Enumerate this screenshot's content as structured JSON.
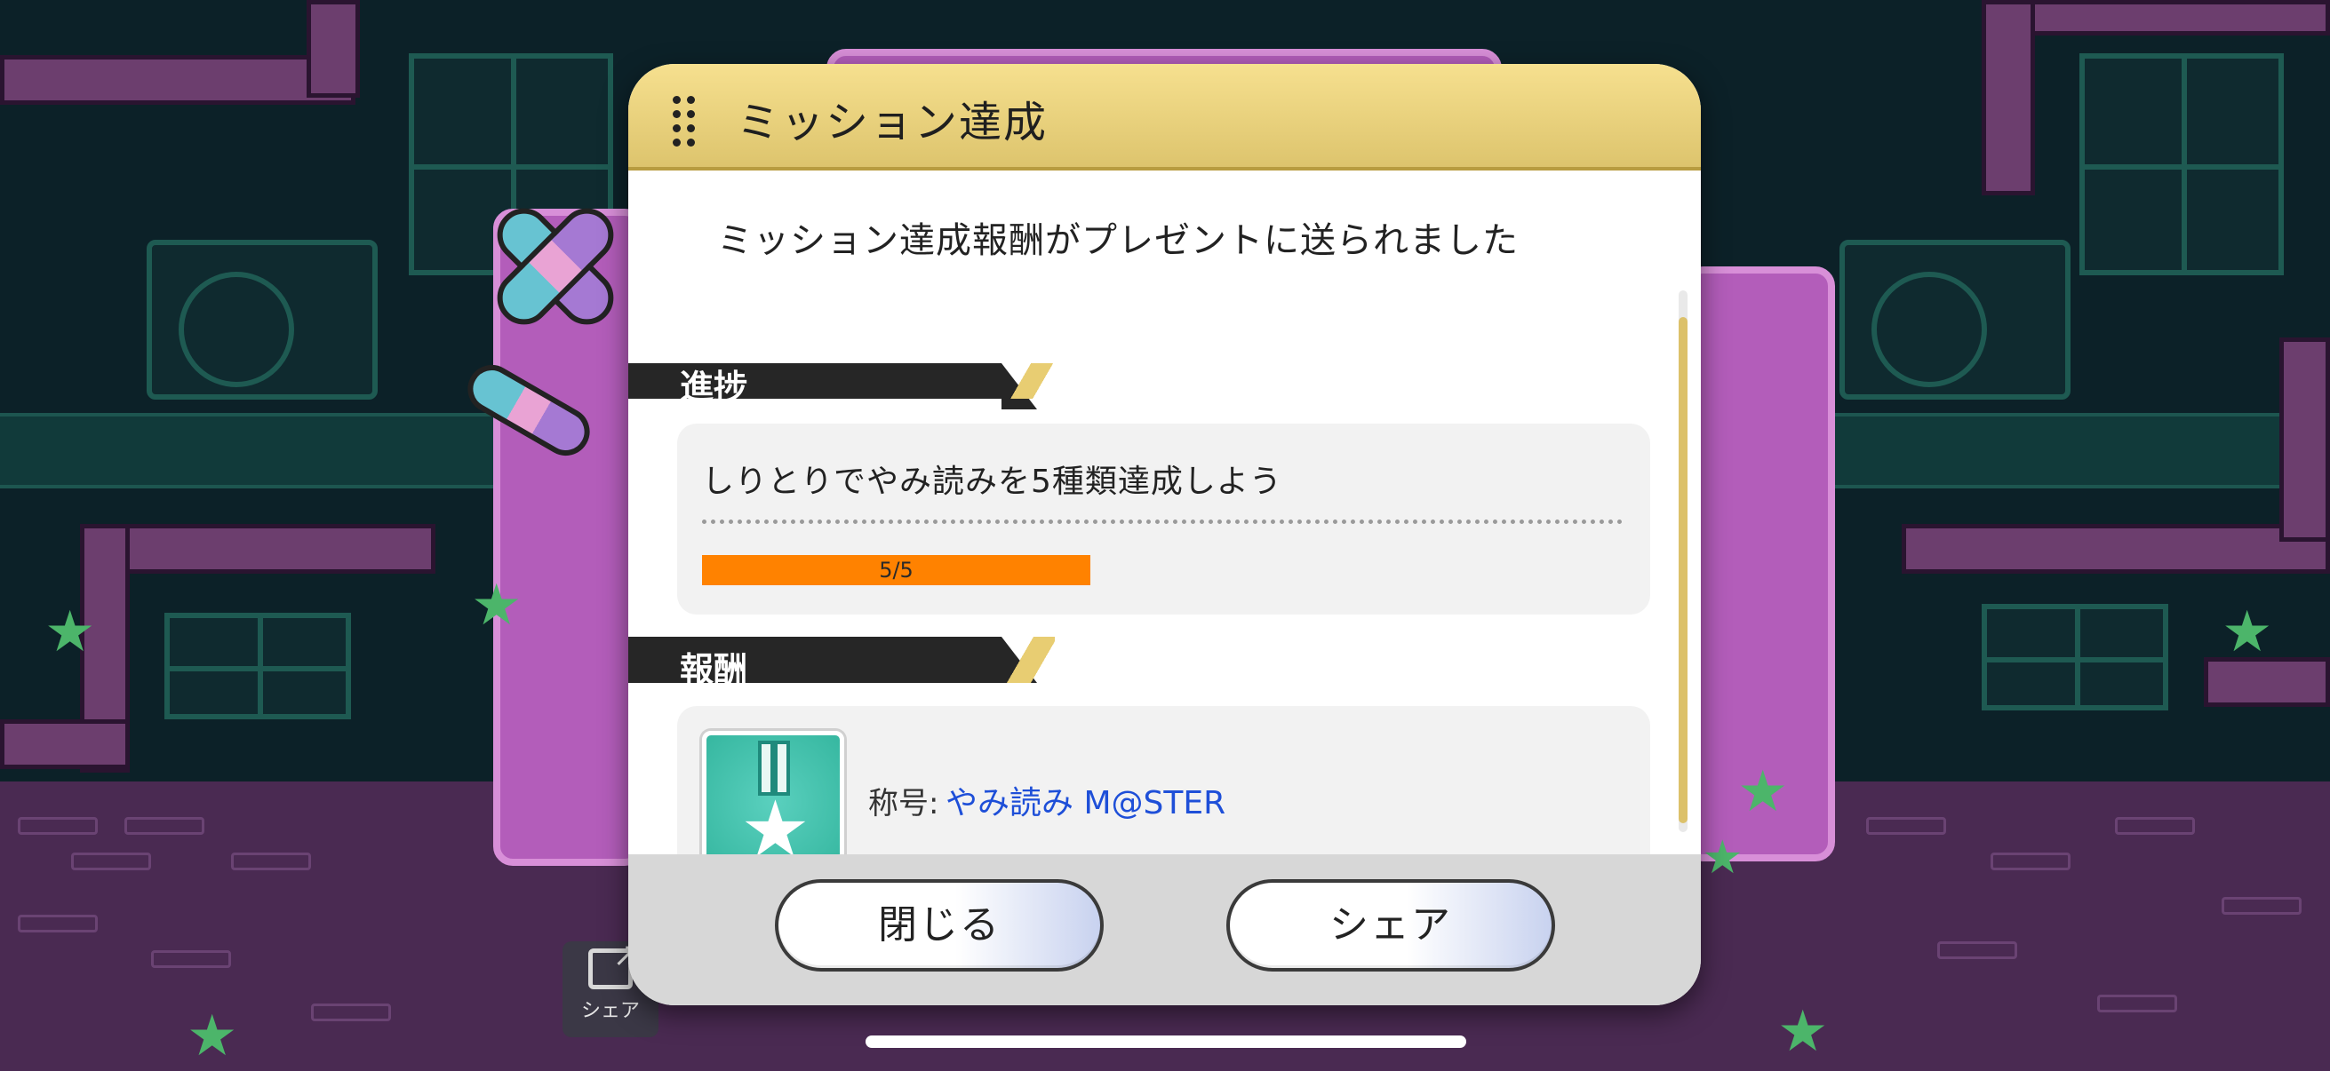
{
  "background": {
    "share_shortcut_label": "シェア",
    "colors": {
      "wall": "#0c2128",
      "floor": "#4a2a52",
      "panel": "#b35dba"
    }
  },
  "dialog": {
    "title": "ミッション達成",
    "message": "ミッション達成報酬がプレゼントに送られました",
    "progress_section": {
      "heading": "進捗",
      "mission": "しりとりでやみ読みを5種類達成しよう",
      "progress_text": "5/5",
      "progress_current": 5,
      "progress_total": 5
    },
    "reward_section": {
      "heading": "報酬",
      "reward_prefix": "称号:",
      "reward_name": "やみ読み M@STER",
      "icon": "medal-star-icon"
    },
    "buttons": {
      "close": "閉じる",
      "share": "シェア"
    },
    "colors": {
      "header_gold": "#ddc46d",
      "progress_fill": "#ff8200",
      "reward_link": "#1e4fd8"
    }
  }
}
